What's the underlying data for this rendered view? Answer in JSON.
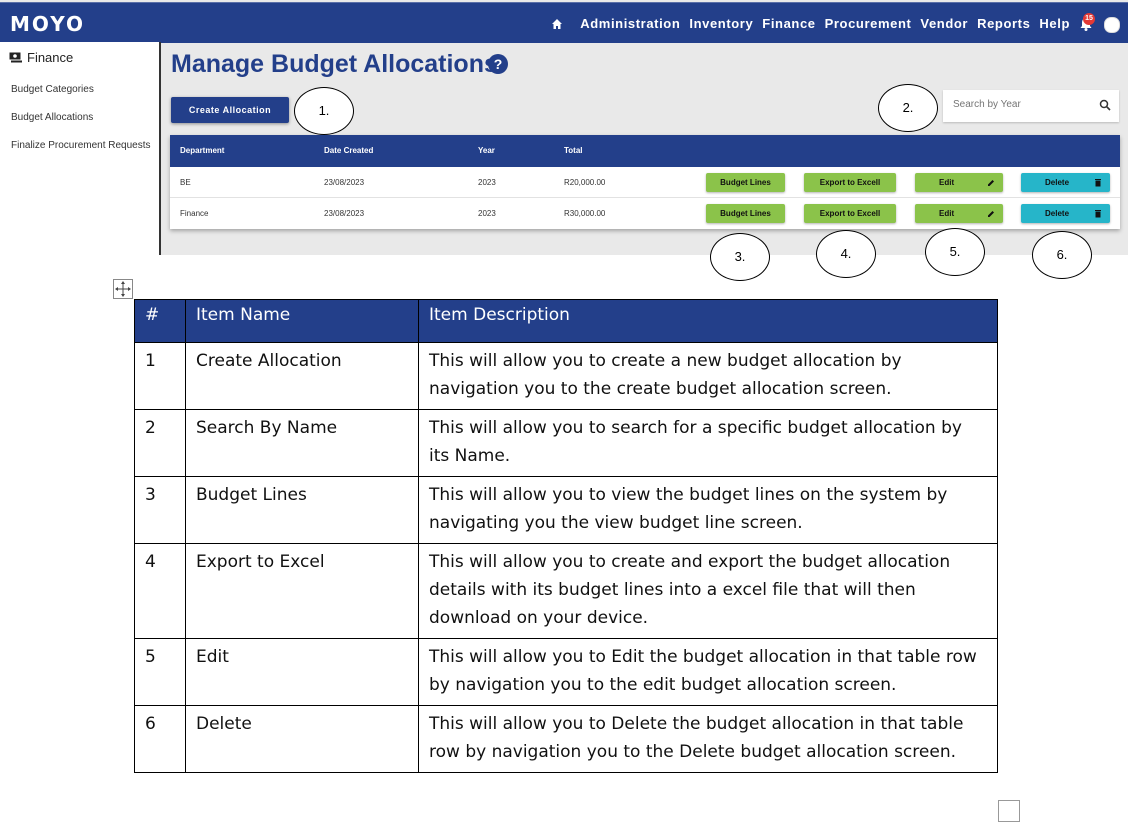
{
  "app": {
    "logo": "MOYO",
    "nav": [
      "Administration",
      "Inventory",
      "Finance",
      "Procurement",
      "Vendor",
      "Reports",
      "Help"
    ],
    "notification_count": "15",
    "sidebar": {
      "title": "Finance",
      "items": [
        "Budget Categories",
        "Budget Allocations",
        "Finalize Procurement Requests"
      ]
    },
    "page_title": "Manage Budget Allocations",
    "create_button": "Create Allocation",
    "search_placeholder": "Search by Year",
    "table": {
      "headers": [
        "Department",
        "Date Created",
        "Year",
        "Total"
      ],
      "rows": [
        {
          "department": "BE",
          "date": "23/08/2023",
          "year": "2023",
          "total": "R20,000.00"
        },
        {
          "department": "Finance",
          "date": "23/08/2023",
          "year": "2023",
          "total": "R30,000.00"
        }
      ],
      "actions": {
        "budget_lines": "Budget Lines",
        "export": "Export to Excell",
        "edit": "Edit",
        "delete": "Delete"
      }
    },
    "callouts": [
      "1.",
      "2.",
      "3.",
      "4.",
      "5.",
      "6."
    ]
  },
  "doc_table": {
    "headers": [
      "#",
      "Item Name",
      "Item Description"
    ],
    "rows": [
      {
        "num": "1",
        "name": "Create Allocation",
        "desc": "This will allow you to create a new budget allocation by navigation you to the create budget allocation screen."
      },
      {
        "num": "2",
        "name": "Search By Name",
        "desc": "This will allow you to search for a specific budget allocation by its Name."
      },
      {
        "num": "3",
        "name": "Budget Lines",
        "desc": "This will allow you to view the budget lines on the system by navigating you the view budget line screen."
      },
      {
        "num": "4",
        "name": "Export to Excel",
        "desc": "This will allow you to create and export the budget allocation details with its budget lines into a excel file that will then download on your device."
      },
      {
        "num": "5",
        "name": "Edit",
        "desc": "This will allow you to Edit the budget allocation in that table row by navigation you to the edit budget allocation screen."
      },
      {
        "num": "6",
        "name": "Delete",
        "desc": "This will allow you to Delete the budget allocation in that table row by navigation you to the Delete budget allocation screen."
      }
    ]
  },
  "colors": {
    "primary": "#233f8a",
    "green": "#8bc34a",
    "teal": "#26b5c9",
    "badge": "#e53935"
  }
}
